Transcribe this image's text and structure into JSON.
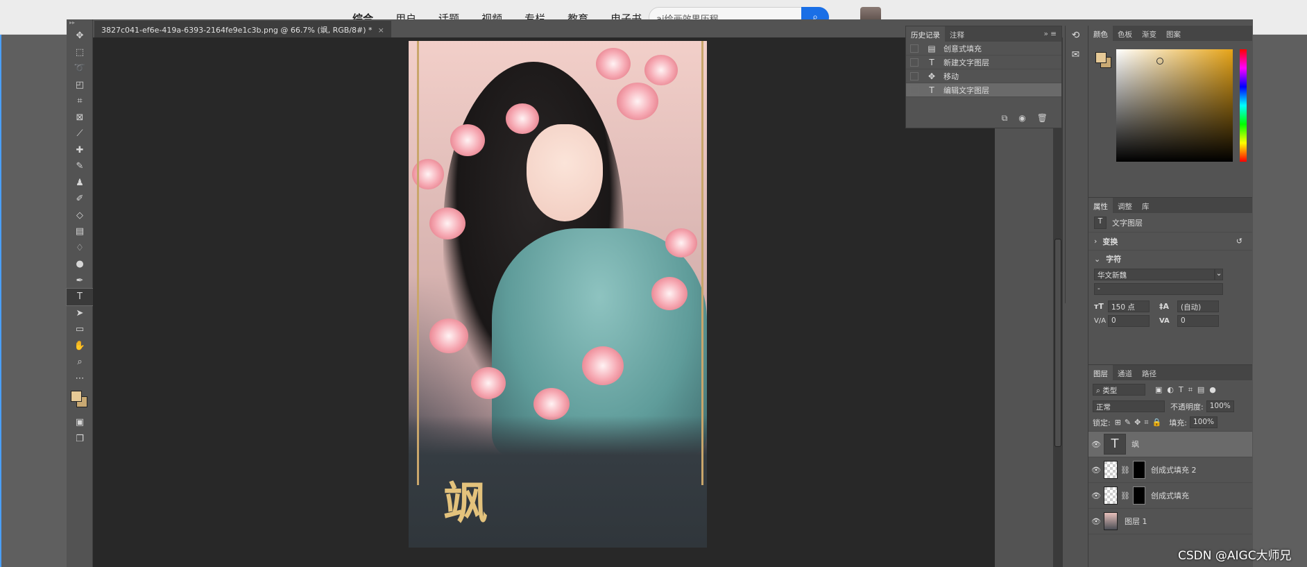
{
  "website": {
    "nav": [
      "综合",
      "用户",
      "话题",
      "视频",
      "专栏",
      "教育",
      "电子书"
    ],
    "search_placeholder": "ai绘画效果历程",
    "search_icon": "search-icon"
  },
  "document": {
    "tab_title": "3827c041-ef6e-419a-6393-2164fe9e1c3b.png @ 66.7% (飒, RGB/8#) *",
    "close_glyph": "×",
    "poster_text": "飒"
  },
  "tools": [
    "move",
    "marquee",
    "lasso",
    "object-select",
    "crop",
    "frame",
    "eyedropper",
    "healing",
    "brush",
    "stamp",
    "history-brush",
    "eraser",
    "gradient",
    "blur",
    "dodge",
    "pen",
    "type",
    "path-select",
    "rectangle",
    "hand",
    "zoom",
    "more"
  ],
  "colors": {
    "foreground": "#e6c996",
    "background": "#c9a973"
  },
  "history": {
    "tabs": [
      "历史记录",
      "注释"
    ],
    "items": [
      {
        "label": "创意式填充",
        "icon": "document-icon"
      },
      {
        "label": "新建文字图层",
        "icon": "type-icon"
      },
      {
        "label": "移动",
        "icon": "move-icon"
      },
      {
        "label": "编辑文字图层",
        "icon": "type-icon",
        "selected": true
      }
    ]
  },
  "color_panel": {
    "tabs": [
      "颜色",
      "色板",
      "渐变",
      "图案"
    ]
  },
  "properties": {
    "tabs": [
      "属性",
      "调整",
      "库"
    ],
    "kind": "文字图层",
    "sections": [
      "变换",
      "字符"
    ],
    "font_family": "华文新魏",
    "font_style": "-",
    "font_size": "150 点",
    "leading": "(自动)",
    "kerning": "0",
    "tracking": "0"
  },
  "layers": {
    "tabs": [
      "图层",
      "通道",
      "路径"
    ],
    "filter": "类型",
    "blend_mode": "正常",
    "opacity_label": "不透明度:",
    "opacity": "100%",
    "lock_label": "锁定:",
    "fill_label": "填充:",
    "fill": "100%",
    "items": [
      {
        "name": "飒",
        "type": "text",
        "selected": true
      },
      {
        "name": "创成式填充 2",
        "type": "mask"
      },
      {
        "name": "创成式填充",
        "type": "mask"
      },
      {
        "name": "图层 1",
        "type": "image"
      }
    ]
  },
  "watermark": "CSDN @AIGC大师兄"
}
